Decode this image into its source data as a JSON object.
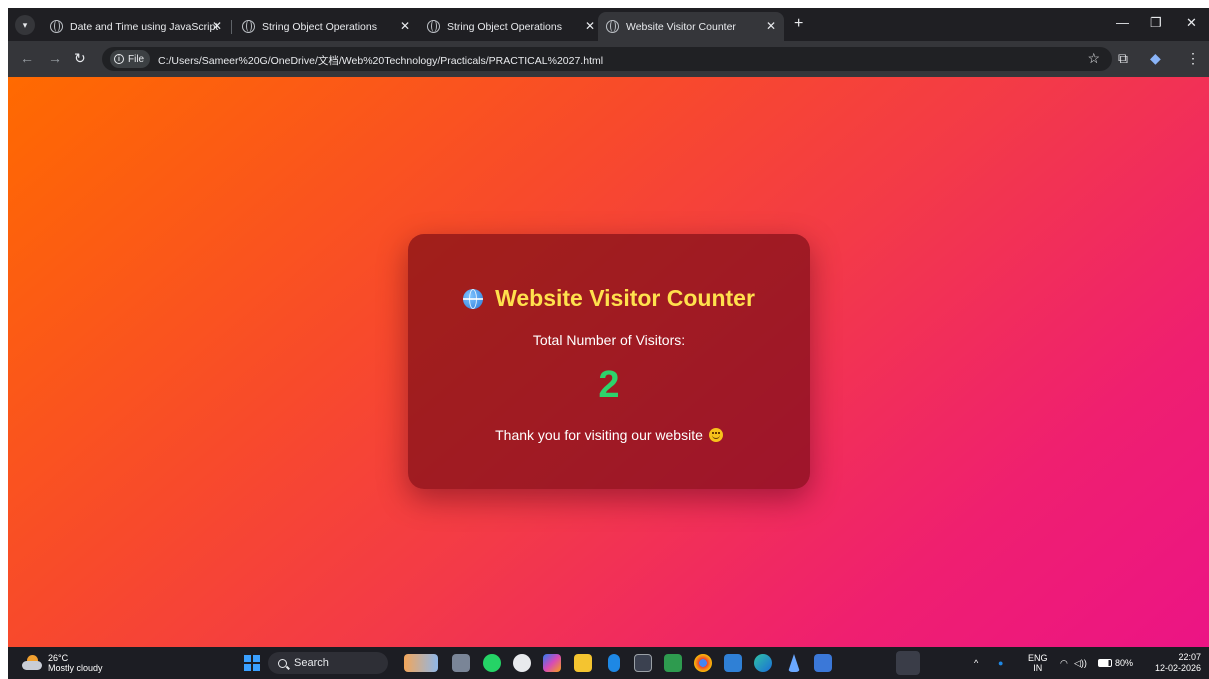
{
  "browser": {
    "tabs": [
      {
        "title": "Date and Time using JavaScript",
        "active": false
      },
      {
        "title": "String Object Operations",
        "active": false
      },
      {
        "title": "String Object Operations",
        "active": false
      },
      {
        "title": "Website Visitor Counter",
        "active": true
      }
    ],
    "url_chip": "File",
    "url": "C:/Users/Sameer%20G/OneDrive/文档/Web%20Technology/Practicals/PRACTICAL%2027.html"
  },
  "page": {
    "heading": "Website Visitor Counter",
    "count_label": "Total Number of Visitors:",
    "count": "2",
    "thanks": "Thank you for visiting our website",
    "colors": {
      "heading": "#ffe14d",
      "count": "#2ed36b",
      "gradient_start": "#ff6a00",
      "gradient_end": "#ec1485"
    }
  },
  "taskbar": {
    "weather_temp": "26°C",
    "weather_desc": "Mostly cloudy",
    "search_placeholder": "Search",
    "lang_top": "ENG",
    "lang_bottom": "IN",
    "battery": "80%",
    "time": "22:07",
    "date": "12-02-2026"
  }
}
